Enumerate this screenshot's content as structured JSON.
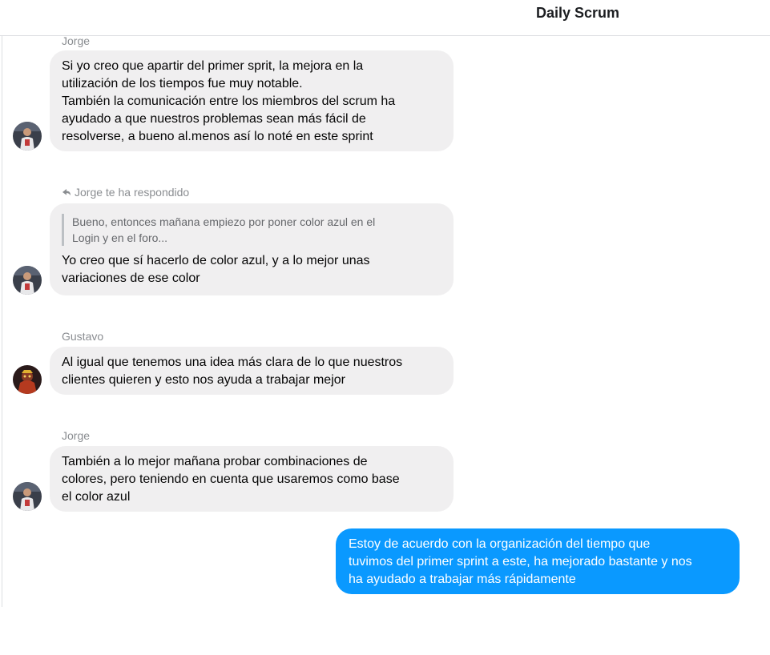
{
  "header": {
    "title": "Daily Scrum"
  },
  "messages": [
    {
      "sender": "Jorge",
      "text": "Si yo creo que apartir del primer sprit, la mejora en la\nutilización de los tiempos fue muy notable.\nTambién la comunicación entre los miembros del scrum ha\nayudado a que nuestros problemas sean más fácil de\nresolverse, a bueno al.menos así lo noté en este sprint"
    },
    {
      "reply_indicator": "Jorge te ha respondido",
      "quoted": "Bueno, entonces mañana empiezo por poner color azul en el\nLogin y en el foro...",
      "text": "Yo creo que sí hacerlo de color azul, y a lo mejor unas\nvariaciones de ese color"
    },
    {
      "sender": "Gustavo",
      "text": "Al igual que tenemos una idea más clara de lo que nuestros\nclientes quieren y esto nos ayuda a trabajar mejor"
    },
    {
      "sender": "Jorge",
      "text": "También a lo mejor mañana probar combinaciones de\ncolores, pero teniendo en cuenta que usaremos como base\nel color azul"
    },
    {
      "text": "Estoy de acuerdo con la organización del tiempo que\ntuvimos del primer sprint a este, ha mejorado bastante y nos\nha ayudado a trabajar más rápidamente"
    }
  ],
  "colors": {
    "incoming_bubble": "#f0eff0",
    "outgoing_bubble": "#0a99ff",
    "meta_text": "#8a8d91"
  },
  "icons": {
    "reply": "reply-arrow-icon",
    "avatar_jorge": "avatar-jorge",
    "avatar_gustavo": "avatar-gustavo"
  }
}
